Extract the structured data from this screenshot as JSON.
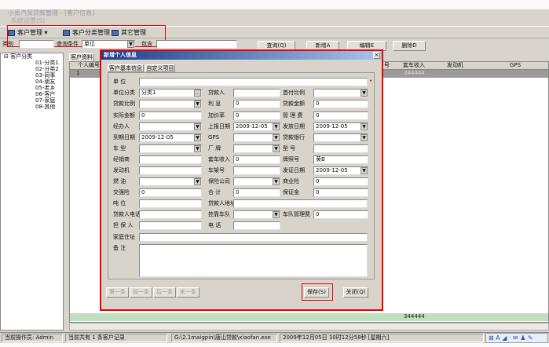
{
  "window": {
    "title": "小贵汽贸贷款管理 - [客户信息]",
    "menu": "系统设置(S)"
  },
  "toolbar": {
    "customer_mgmt": "客户管理",
    "category_mgmt": "客户分类管理",
    "other_mgmt": "其它管理"
  },
  "search": {
    "category_label": "类别",
    "category_value": "",
    "condition_label": "查询条件",
    "condition_value": "单位",
    "contains_label": "包含",
    "contains_value": "",
    "query": "查询(Q)",
    "add": "新增A",
    "edit": "编辑E",
    "delete": "删除D"
  },
  "tree": {
    "root": "客户分类",
    "items": [
      "01-分类1",
      "02-分类2",
      "03-同事",
      "04-朋友",
      "05-老乡",
      "06-客户",
      "07-家庭",
      "08-其他"
    ]
  },
  "grid": {
    "tab": "客户资料",
    "col_id": "个人编号",
    "row_id": "1",
    "cols": [
      "号",
      "套车收入",
      "发动机",
      "GPS"
    ],
    "row_income": "344444",
    "total_income": "344444"
  },
  "dialog": {
    "title": "新增个人信息",
    "tabs": [
      "客户基本信息",
      "自定义项目"
    ],
    "unit_label": "单 位",
    "unit_value": "",
    "rows": [
      [
        {
          "l": "单位分类",
          "v": "分类1",
          "t": "btn"
        },
        {
          "l": "贷款人",
          "v": "",
          "t": "text"
        },
        {
          "l": "首付比例",
          "v": "",
          "t": "dd"
        }
      ],
      [
        {
          "l": "贷款比例",
          "v": "",
          "t": "dd"
        },
        {
          "l": "利 息",
          "v": "0",
          "t": "text"
        },
        {
          "l": "贷款金额",
          "v": "0",
          "t": "text"
        }
      ],
      [
        {
          "l": "实际金额",
          "v": "0",
          "t": "text"
        },
        {
          "l": "加价率",
          "v": "0",
          "t": "text"
        },
        {
          "l": "管 理 费",
          "v": "0",
          "t": "text"
        }
      ],
      [
        {
          "l": "经办人",
          "v": "",
          "t": "dd"
        },
        {
          "l": "上报日期",
          "v": "2009-12-05",
          "t": "dd"
        },
        {
          "l": "发放日期",
          "v": "2009-12-05",
          "t": "dd"
        }
      ],
      [
        {
          "l": "到期日期",
          "v": "2009-12-05",
          "t": "dd"
        },
        {
          "l": "GPS",
          "v": "",
          "t": "dd"
        },
        {
          "l": "贷款银行",
          "v": "",
          "t": "dd"
        }
      ],
      [
        {
          "l": "车 型",
          "v": "",
          "t": "dd"
        },
        {
          "l": "厂 牌",
          "v": "",
          "t": "dd"
        },
        {
          "l": "型 号",
          "v": "",
          "t": "text"
        }
      ],
      [
        {
          "l": "经销商",
          "v": "",
          "t": "text"
        },
        {
          "l": "套车收入",
          "v": "0",
          "t": "text"
        },
        {
          "l": "牌照号",
          "v": "黄B",
          "t": "text"
        }
      ],
      [
        {
          "l": "发动机",
          "v": "",
          "t": "text"
        },
        {
          "l": "车架号",
          "v": "",
          "t": "text"
        },
        {
          "l": "发证日期",
          "v": "2009-12-05",
          "t": "dd"
        }
      ],
      [
        {
          "l": "燃 油",
          "v": "",
          "t": "dd"
        },
        {
          "l": "保险公司",
          "v": "",
          "t": "dd"
        },
        {
          "l": "商业险",
          "v": "0",
          "t": "text"
        }
      ],
      [
        {
          "l": "交强险",
          "v": "0",
          "t": "text"
        },
        {
          "l": "合 计",
          "v": "0",
          "t": "text"
        },
        {
          "l": "保证金",
          "v": "0",
          "t": "text"
        }
      ],
      [
        {
          "l": "吨 位",
          "v": "",
          "t": "text"
        },
        {
          "l": "贷款人地址",
          "v": "",
          "t": "wide"
        }
      ],
      [
        {
          "l": "贷款人电话",
          "v": "",
          "t": "text"
        },
        {
          "l": "挂靠车队",
          "v": "",
          "t": "dd"
        },
        {
          "l": "车队管理费",
          "v": "0",
          "t": "text"
        }
      ],
      [
        {
          "l": "担 保 人",
          "v": "",
          "t": "text"
        },
        {
          "l": "电 话",
          "v": "",
          "t": "text"
        }
      ]
    ],
    "address_label": "家庭住址",
    "address_value": "",
    "remark_label": "备 注",
    "remark_value": "",
    "nav": [
      "第一条",
      "前一条",
      "后一条",
      "末一条"
    ],
    "save": "保存(S)",
    "close": "关闭(Q)"
  },
  "status": {
    "operator": "当前操作员: Admin",
    "count": "当前共有 1 条客户记录",
    "path": "G:\\2.1maigpin\\唐山贷款\\xiaofan.exe",
    "time": "2009年12月05日 10时12分58秒 [星期六]"
  }
}
